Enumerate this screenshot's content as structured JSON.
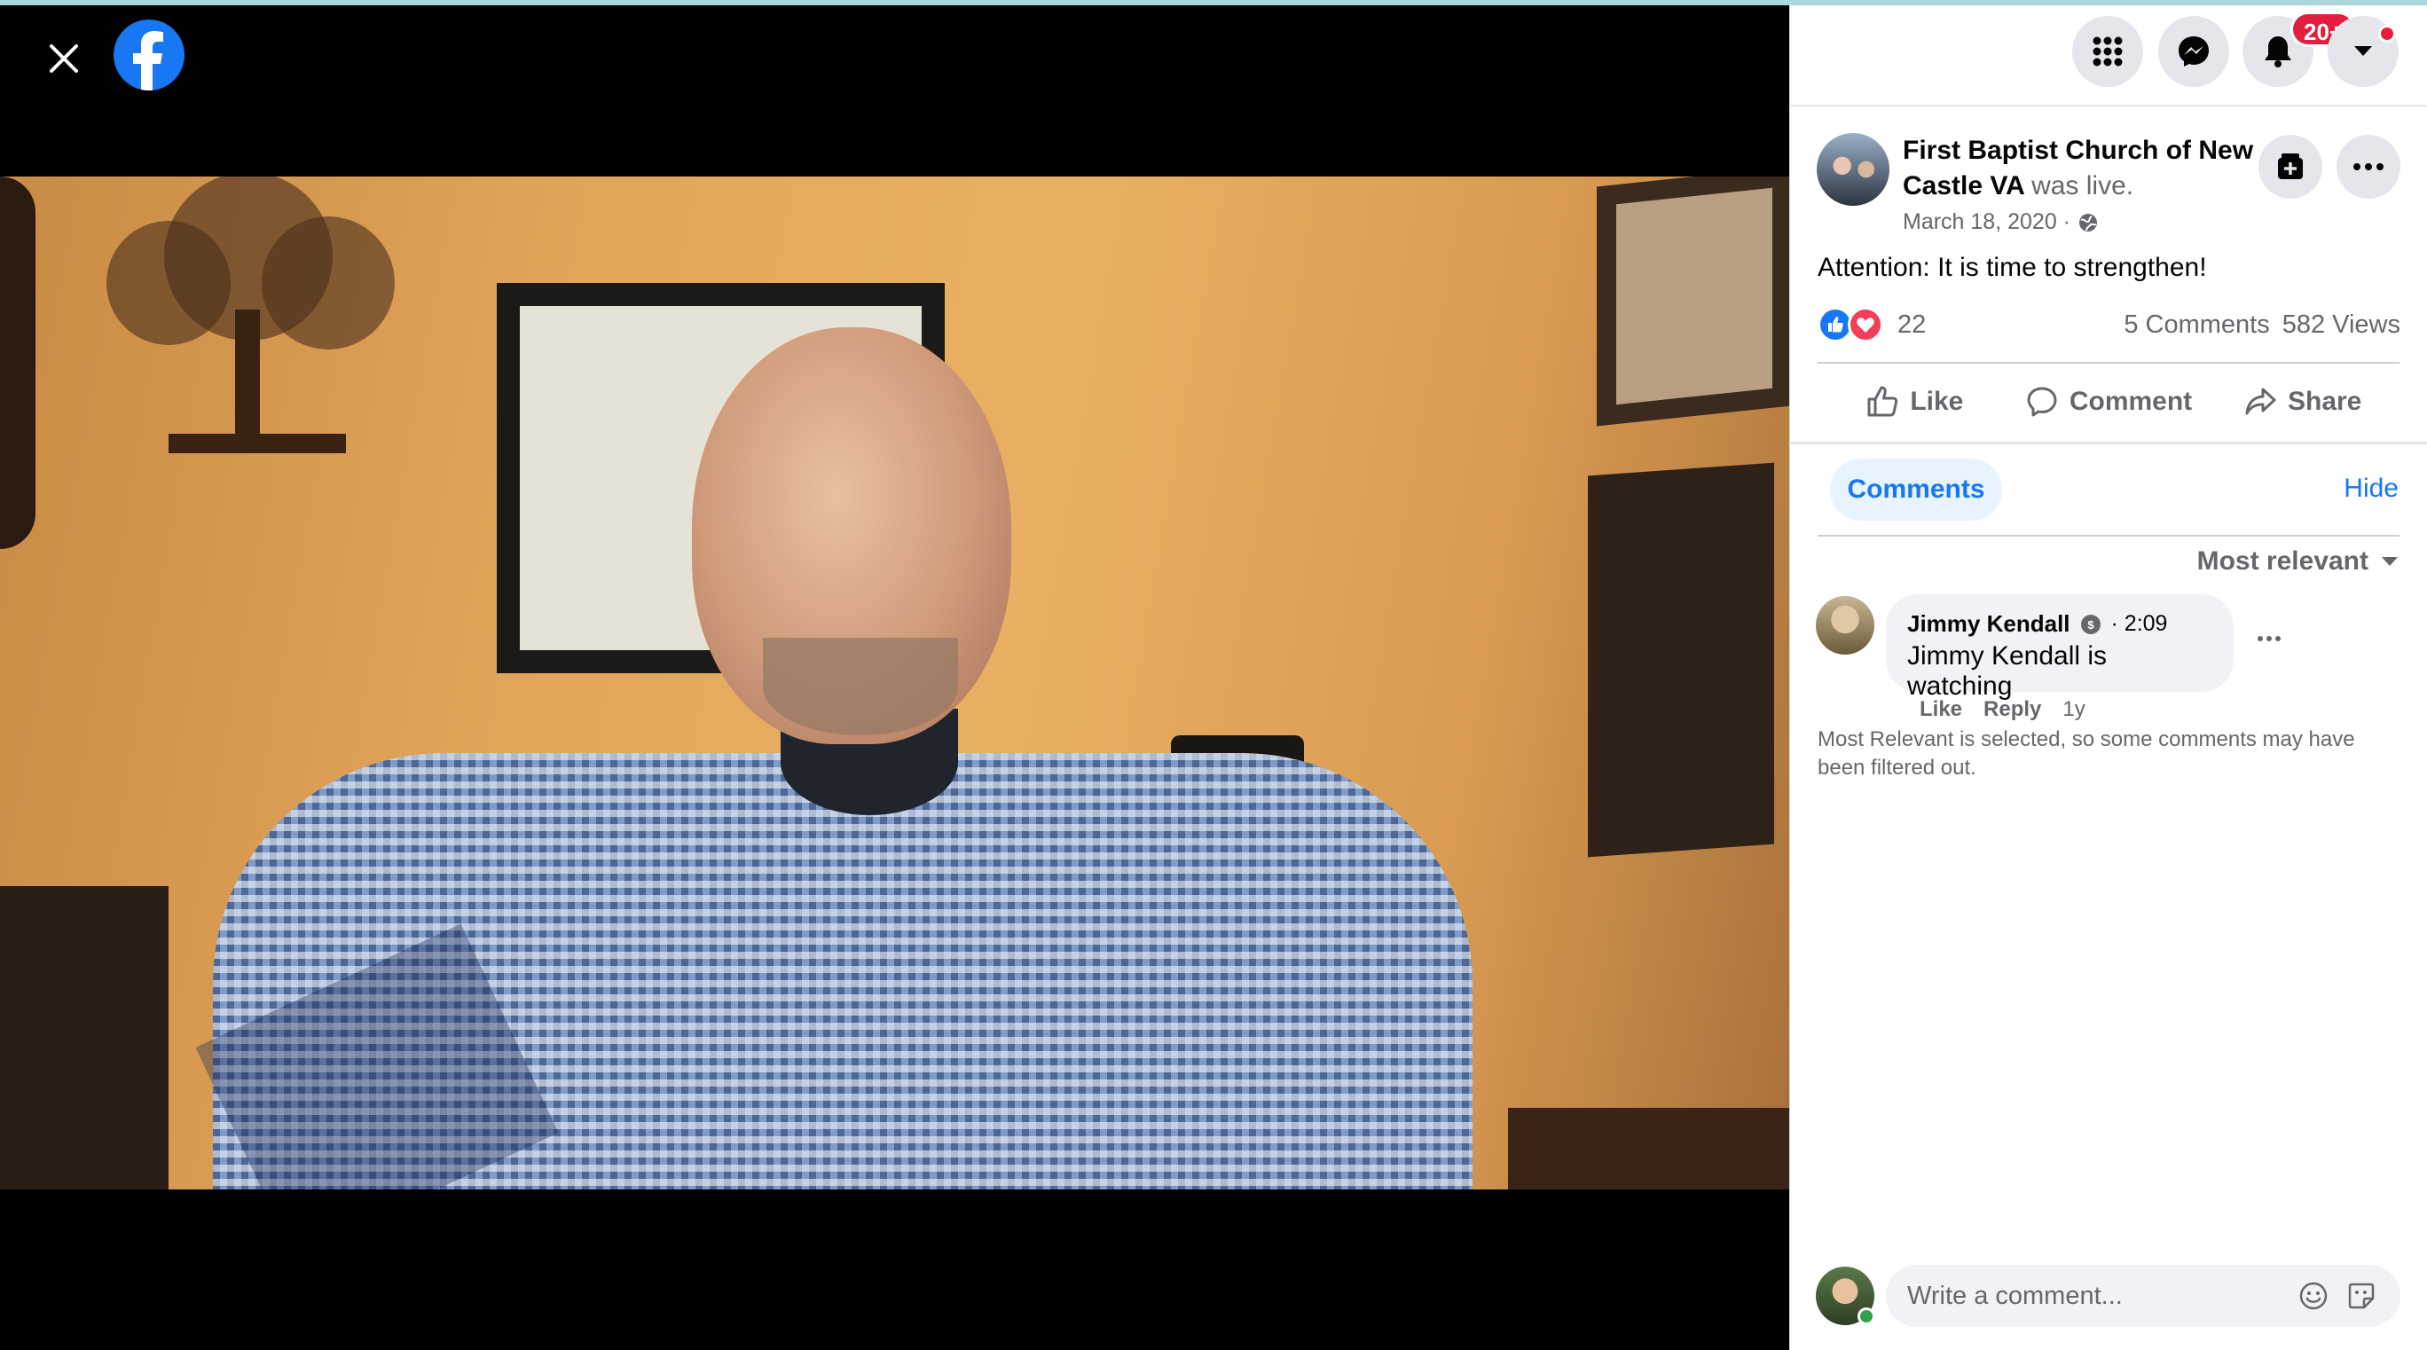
{
  "header": {
    "notification_badge": "20+"
  },
  "post": {
    "page_name": "First Baptist Church of New Castle VA",
    "status": "was live.",
    "date": "March 18, 2020 ·",
    "privacy_icon": "globe-icon",
    "text": "Attention: It is time to strengthen!",
    "reaction_count": "22",
    "comments_count": "5 Comments",
    "views_count": "582 Views"
  },
  "actions": {
    "like": "Like",
    "comment": "Comment",
    "share": "Share"
  },
  "comments_section": {
    "tab_label": "Comments",
    "hide_label": "Hide",
    "sort_label": "Most relevant",
    "filter_note": "Most Relevant is selected, so some comments may have been filtered out.",
    "composer_placeholder": "Write a comment..."
  },
  "comments": [
    {
      "author": "Jimmy Kendall",
      "time": "· 2:09",
      "text": "Jimmy Kendall is watching",
      "like": "Like",
      "reply": "Reply",
      "age": "1y"
    }
  ],
  "colors": {
    "brand": "#1877f2",
    "notification": "#e41e3f",
    "love": "#f33e58"
  }
}
